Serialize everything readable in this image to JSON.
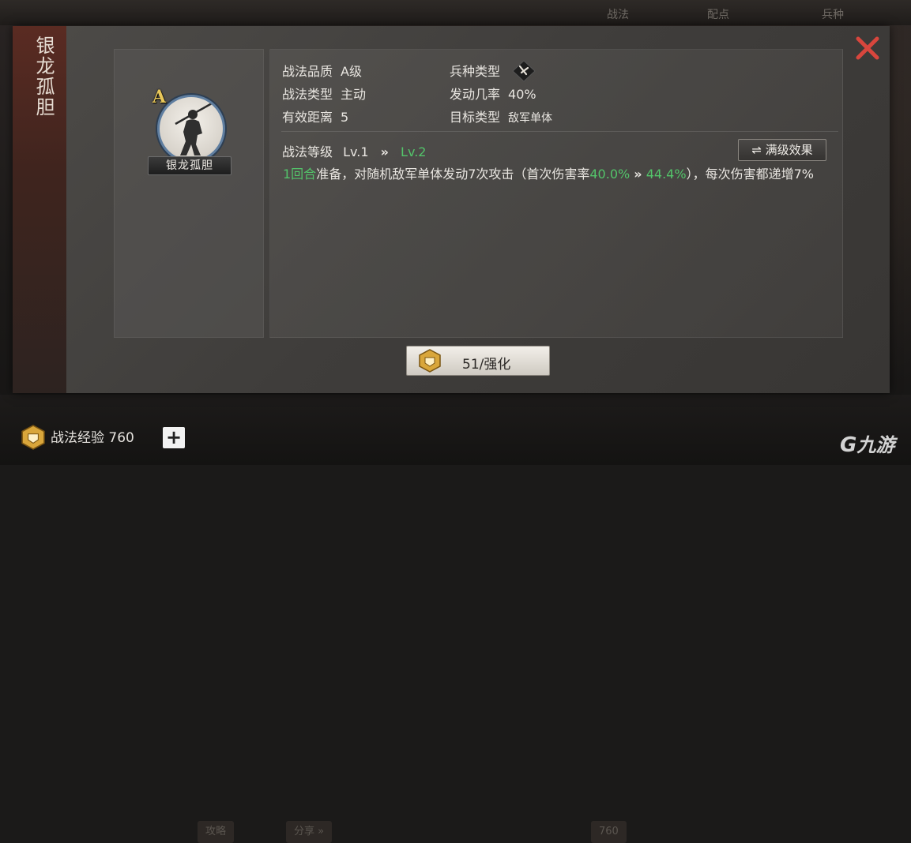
{
  "background": {
    "top_tabs": [
      "战法",
      "配点",
      "兵种"
    ],
    "bottom_buttons": [
      "攻略",
      "分享 »",
      "760"
    ]
  },
  "dialog": {
    "title": "银龙孤胆",
    "skill": {
      "grade_letter": "A",
      "name": "银龙孤胆"
    },
    "attributes": [
      {
        "label": "战法品质",
        "value": "A级"
      },
      {
        "label": "兵种类型",
        "value": "",
        "icon": "troop-type-icon"
      },
      {
        "label": "战法类型",
        "value": "主动"
      },
      {
        "label": "发动几率",
        "value": "40%"
      },
      {
        "label": "有效距离",
        "value": "5"
      },
      {
        "label": "目标类型",
        "value": "敌军单体"
      }
    ],
    "level": {
      "label": "战法等级",
      "current": "Lv.1",
      "arrow": "»",
      "next": "Lv.2"
    },
    "full_effect_button": "满级效果",
    "description": {
      "part1": "1回合",
      "part2": "准备，对随机敌军单体发动7次攻击（首次伤害率",
      "rate_current": "40.0%",
      "arrow": "»",
      "rate_next": "44.4%",
      "part3": "），每次伤害都递增7%"
    },
    "enhance_button": "51/强化"
  },
  "footer": {
    "exp_label": "战法经验 760",
    "plus": "+",
    "watermark": "九游"
  },
  "colors": {
    "highlight_green": "#53c46a",
    "close_red": "#d8463d",
    "gold": "#e8c75a"
  }
}
